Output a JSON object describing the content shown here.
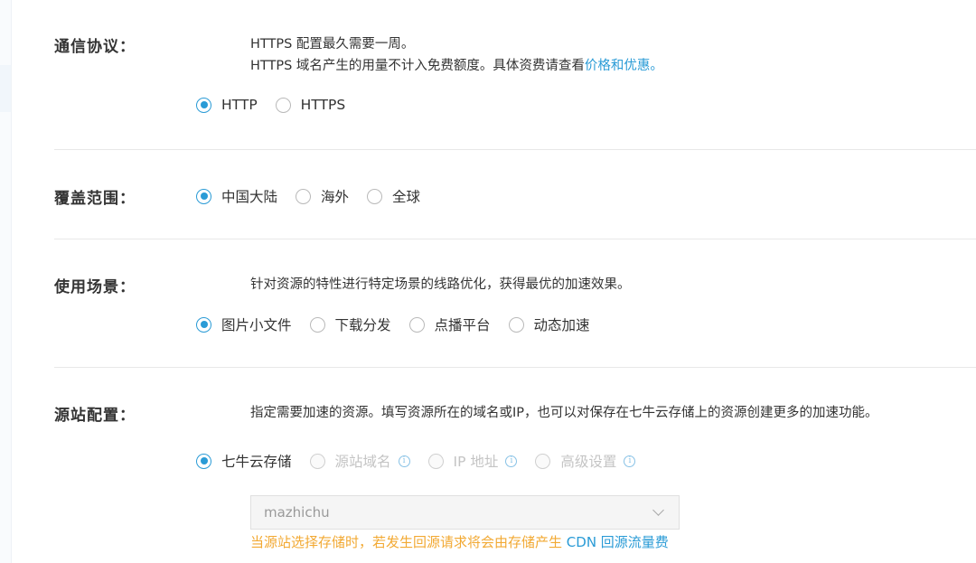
{
  "protocol": {
    "label": "通信协议：",
    "line1": "HTTPS 配置最久需要一周。",
    "line2_text": "HTTPS 域名产生的用量不计入免费额度。具体资费请查看",
    "line2_link": "价格和优惠。",
    "options": [
      "HTTP",
      "HTTPS"
    ],
    "selected": "HTTP"
  },
  "coverage": {
    "label": "覆盖范围：",
    "options": [
      "中国大陆",
      "海外",
      "全球"
    ],
    "selected": "中国大陆"
  },
  "scenario": {
    "label": "使用场景：",
    "description": "针对资源的特性进行特定场景的线路优化，获得最优的加速效果。",
    "options": [
      "图片小文件",
      "下载分发",
      "点播平台",
      "动态加速"
    ],
    "selected": "图片小文件"
  },
  "origin": {
    "label": "源站配置：",
    "description": "指定需要加速的资源。填写资源所在的域名或IP，也可以对保存在七牛云存储上的资源创建更多的加速功能。",
    "options": [
      "七牛云存储",
      "源站域名",
      "IP 地址",
      "高级设置"
    ],
    "selected": "七牛云存储",
    "disabled_options": [
      "源站域名",
      "IP 地址",
      "高级设置"
    ],
    "bucket_value": "mazhichu",
    "warning_text": "当源站选择存储时，若发生回源请求将会由存储产生",
    "warning_link": "CDN 回源流量费"
  },
  "colors": {
    "accent": "#2a9bd6",
    "warning": "#f2a933",
    "divider": "#e8e8e8"
  },
  "icons": {
    "info": "info-circle-icon",
    "dropdown": "chevron-down-icon"
  }
}
